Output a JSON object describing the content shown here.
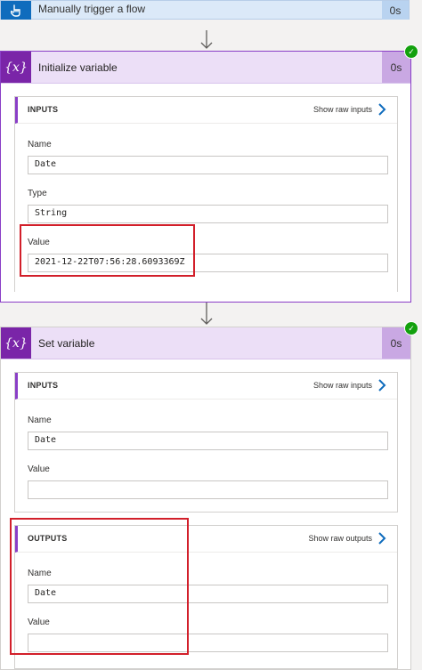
{
  "trigger": {
    "title": "Manually trigger a flow",
    "duration": "0s"
  },
  "init_var": {
    "title": "Initialize variable",
    "duration": "0s",
    "inputs_label": "INPUTS",
    "show_raw_inputs": "Show raw inputs",
    "name_label": "Name",
    "name_value": "Date",
    "type_label": "Type",
    "type_value": "String",
    "value_label": "Value",
    "value_value": "2021-12-22T07:56:28.6093369Z"
  },
  "set_var": {
    "title": "Set variable",
    "duration": "0s",
    "inputs_label": "INPUTS",
    "show_raw_inputs": "Show raw inputs",
    "name_label": "Name",
    "name_value": "Date",
    "value_label": "Value",
    "value_value": "",
    "outputs_label": "OUTPUTS",
    "show_raw_outputs": "Show raw outputs",
    "out_name_label": "Name",
    "out_name_value": "Date",
    "out_value_label": "Value",
    "out_value_value": ""
  },
  "colors": {
    "accent_purple": "#8a3ec7",
    "variable_icon_bg": "#7a25a8",
    "trigger_icon_bg": "#0f6cbd",
    "success_green": "#13a10e",
    "highlight_red": "#d21f2a"
  },
  "icons": [
    "hand-pointer-icon",
    "variable-icon",
    "arrow-down-icon",
    "chevron-right-icon",
    "success-check-icon"
  ]
}
